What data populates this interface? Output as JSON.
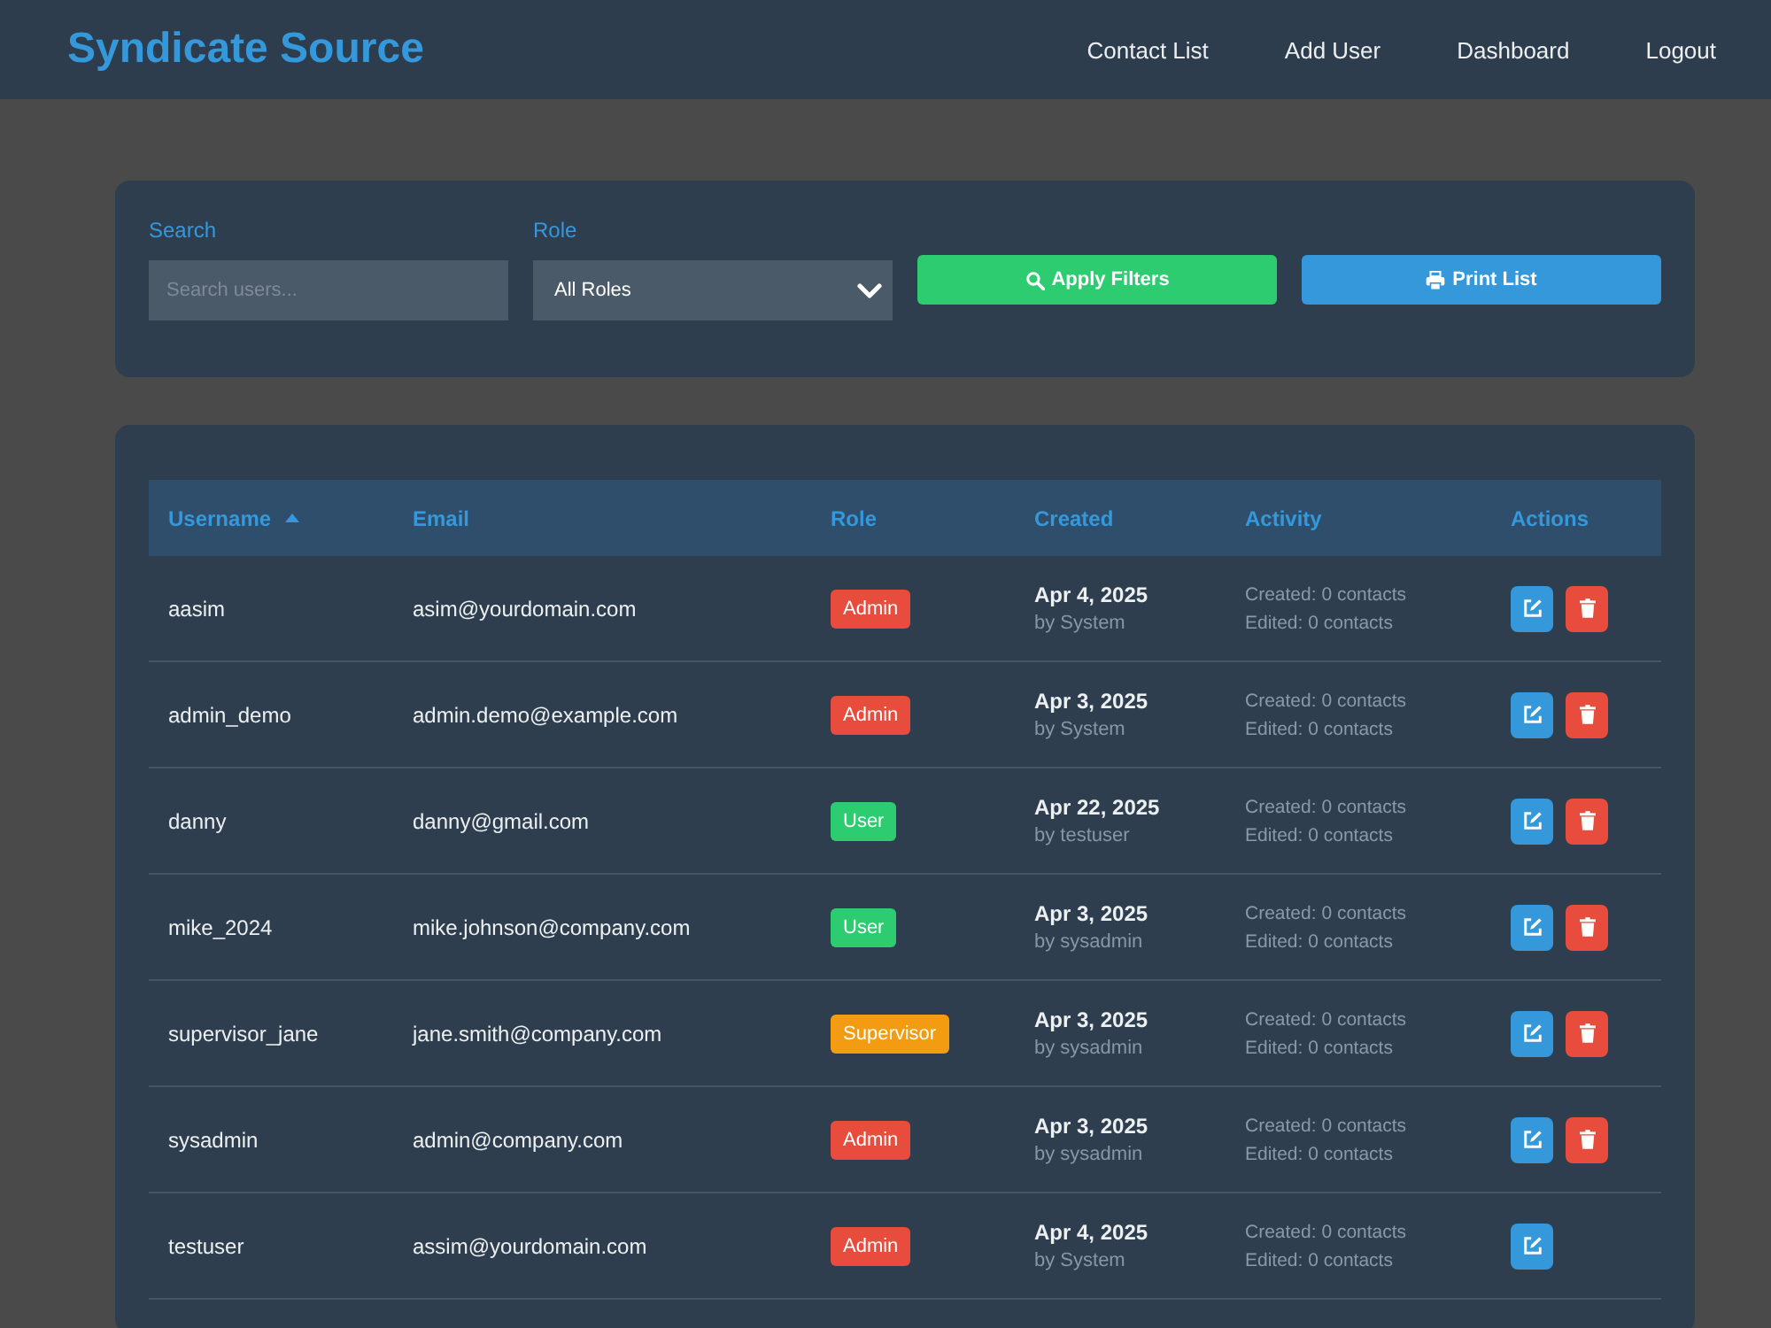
{
  "header": {
    "title": "Syndicate Source",
    "nav": [
      "Contact List",
      "Add User",
      "Dashboard",
      "Logout"
    ]
  },
  "filters": {
    "search": {
      "label": "Search",
      "placeholder": "Search users..."
    },
    "role": {
      "label": "Role",
      "value": "All Roles"
    },
    "buttons": [
      {
        "label": "Apply Filters",
        "kind": "apply"
      },
      {
        "label": "Print List",
        "kind": "print"
      }
    ]
  },
  "table": {
    "columns": [
      {
        "label": "Username",
        "sorted": true
      },
      {
        "label": "Email",
        "sorted": false
      },
      {
        "label": "Role",
        "sorted": false
      },
      {
        "label": "Created",
        "sorted": false
      },
      {
        "label": "Activity",
        "sorted": false
      },
      {
        "label": "Actions",
        "sorted": false
      }
    ],
    "rows": [
      {
        "username": "aasim",
        "email": "asim@yourdomain.com",
        "role": {
          "label": "Admin",
          "color": "#e74c3c"
        },
        "created": "Apr 4, 2025",
        "created_by": "by System",
        "activity": [
          "Created: 0 contacts",
          "Edited: 0 contacts"
        ],
        "actions": [
          {
            "kind": "edit"
          },
          {
            "kind": "delete"
          }
        ]
      },
      {
        "username": "admin_demo",
        "email": "admin.demo@example.com",
        "role": {
          "label": "Admin",
          "color": "#e74c3c"
        },
        "created": "Apr 3, 2025",
        "created_by": "by System",
        "activity": [
          "Created: 0 contacts",
          "Edited: 0 contacts"
        ],
        "actions": [
          {
            "kind": "edit"
          },
          {
            "kind": "delete"
          }
        ]
      },
      {
        "username": "danny",
        "email": "danny@gmail.com",
        "role": {
          "label": "User",
          "color": "#2ecc71"
        },
        "created": "Apr 22, 2025",
        "created_by": "by testuser",
        "activity": [
          "Created: 0 contacts",
          "Edited: 0 contacts"
        ],
        "actions": [
          {
            "kind": "edit"
          },
          {
            "kind": "delete"
          }
        ]
      },
      {
        "username": "mike_2024",
        "email": "mike.johnson@company.com",
        "role": {
          "label": "User",
          "color": "#2ecc71"
        },
        "created": "Apr 3, 2025",
        "created_by": "by sysadmin",
        "activity": [
          "Created: 0 contacts",
          "Edited: 0 contacts"
        ],
        "actions": [
          {
            "kind": "edit"
          },
          {
            "kind": "delete"
          }
        ]
      },
      {
        "username": "supervisor_jane",
        "email": "jane.smith@company.com",
        "role": {
          "label": "Supervisor",
          "color": "#f39c12"
        },
        "created": "Apr 3, 2025",
        "created_by": "by sysadmin",
        "activity": [
          "Created: 0 contacts",
          "Edited: 0 contacts"
        ],
        "actions": [
          {
            "kind": "edit"
          },
          {
            "kind": "delete"
          }
        ]
      },
      {
        "username": "sysadmin",
        "email": "admin@company.com",
        "role": {
          "label": "Admin",
          "color": "#e74c3c"
        },
        "created": "Apr 3, 2025",
        "created_by": "by sysadmin",
        "activity": [
          "Created: 0 contacts",
          "Edited: 0 contacts"
        ],
        "actions": [
          {
            "kind": "edit"
          },
          {
            "kind": "delete"
          }
        ]
      },
      {
        "username": "testuser",
        "email": "assim@yourdomain.com",
        "role": {
          "label": "Admin",
          "color": "#e74c3c"
        },
        "created": "Apr 4, 2025",
        "created_by": "by System",
        "activity": [
          "Created: 0 contacts",
          "Edited: 0 contacts"
        ],
        "actions": [
          {
            "kind": "edit"
          }
        ]
      }
    ]
  }
}
